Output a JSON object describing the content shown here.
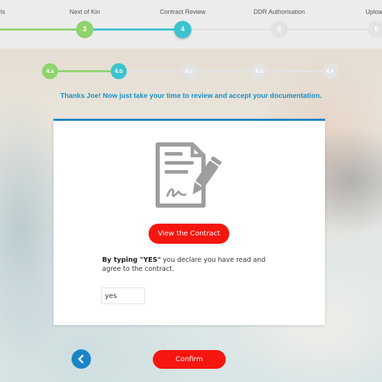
{
  "top_steps": [
    {
      "label": "ls",
      "num": "",
      "state": "done"
    },
    {
      "label": "Next of Kin",
      "num": "3",
      "state": "done"
    },
    {
      "label": "Contract Review",
      "num": "4",
      "state": "active"
    },
    {
      "label": "DDR Authorisation",
      "num": "5",
      "state": "pending"
    },
    {
      "label": "Uploa",
      "num": "6",
      "state": "pending"
    }
  ],
  "sub_steps": [
    {
      "label": "4.a",
      "state": "done"
    },
    {
      "label": "4.b",
      "state": "active"
    },
    {
      "label": "4.c",
      "state": "pending"
    },
    {
      "label": "4.d",
      "state": "pending"
    },
    {
      "label": "4.e",
      "state": "pending"
    }
  ],
  "thanks_message": "Thanks Joe! Now just take your time to review and accept your documentation.",
  "card": {
    "view_button": "View the Contract",
    "declare_prefix": "By typing ",
    "declare_keyword": "\"YES\"",
    "declare_suffix": " you declare you have read and agree to the contract.",
    "input_value": "yes"
  },
  "footer": {
    "confirm_button": "Confirm",
    "back_icon": "chevron-left-icon"
  },
  "colors": {
    "done": "#8fd46e",
    "active": "#3cc3cf",
    "pending": "#e3e3e3",
    "accent_blue": "#1b84c6",
    "button_red": "#f5160f"
  }
}
